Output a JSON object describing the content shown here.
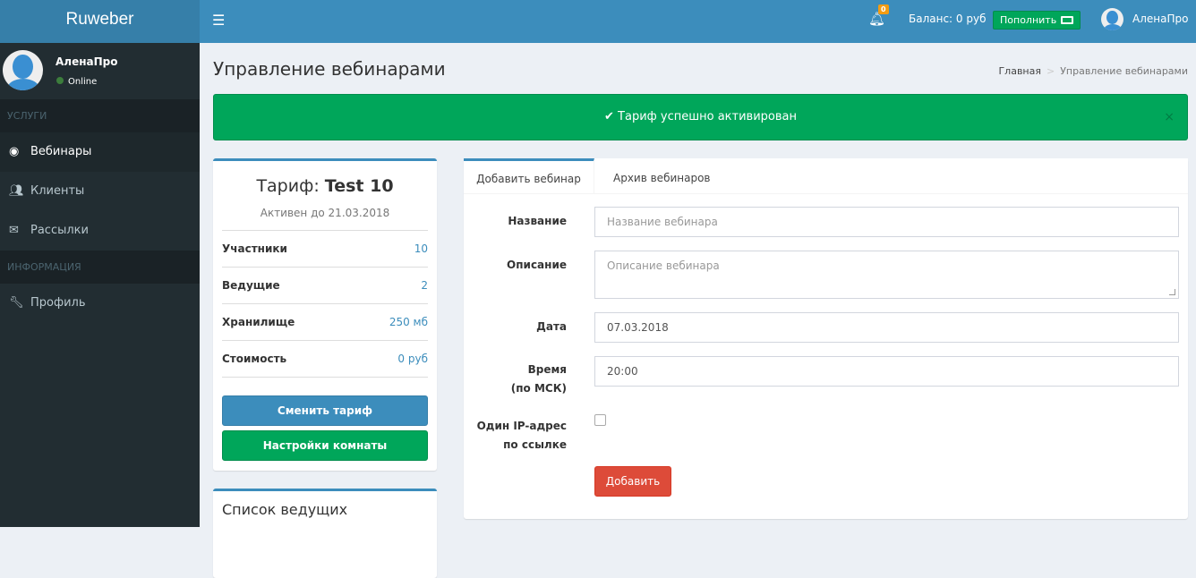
{
  "header": {
    "logo": "Ruweber",
    "notifications_count": "0",
    "balance": "Баланс: 0 руб",
    "topup_label": "Пополнить",
    "user_name": "АленаПро"
  },
  "sidebar": {
    "user_name": "АленаПро",
    "status": "Online",
    "sections": [
      {
        "title": "УСЛУГИ"
      },
      {
        "title": "ИНФОРМАЦИЯ"
      }
    ],
    "items": [
      {
        "label": "Вебинары",
        "icon": "globe-icon"
      },
      {
        "label": "Клиенты",
        "icon": "users-icon"
      },
      {
        "label": "Рассылки",
        "icon": "envelope-icon"
      },
      {
        "label": "Профиль",
        "icon": "wrench-icon"
      }
    ]
  },
  "page": {
    "title": "Управление вебинарами",
    "breadcrumb": [
      "Главная",
      "Управление вебинарами"
    ]
  },
  "alert": {
    "text": "Тариф успешно активирован",
    "close": "×"
  },
  "plan": {
    "title_prefix": "Тариф: ",
    "name": "Test 10",
    "active_until": "Активен до 21.03.2018",
    "rows": [
      {
        "key": "Участники",
        "value": "10"
      },
      {
        "key": "Ведущие",
        "value": "2"
      },
      {
        "key": "Хранилище",
        "value": "250 мб"
      },
      {
        "key": "Стоимость",
        "value": "0 руб"
      }
    ],
    "change_button": "Сменить тариф",
    "room_button": "Настройки комнаты"
  },
  "hosts": {
    "title": "Список ведущих"
  },
  "form": {
    "tabs": [
      "Добавить вебинар",
      "Архив вебинаров"
    ],
    "name_label": "Название",
    "name_placeholder": "Название вебинара",
    "desc_label": "Описание",
    "desc_placeholder": "Описание вебинара",
    "date_label": "Дата",
    "date_value": "07.03.2018",
    "time_label": "Время",
    "time_label2": "(по МСК)",
    "time_value": "20:00",
    "ip_label": "Один IP-адрес",
    "ip_label2": "по ссылке",
    "ip_checked": false,
    "submit": "Добавить"
  }
}
